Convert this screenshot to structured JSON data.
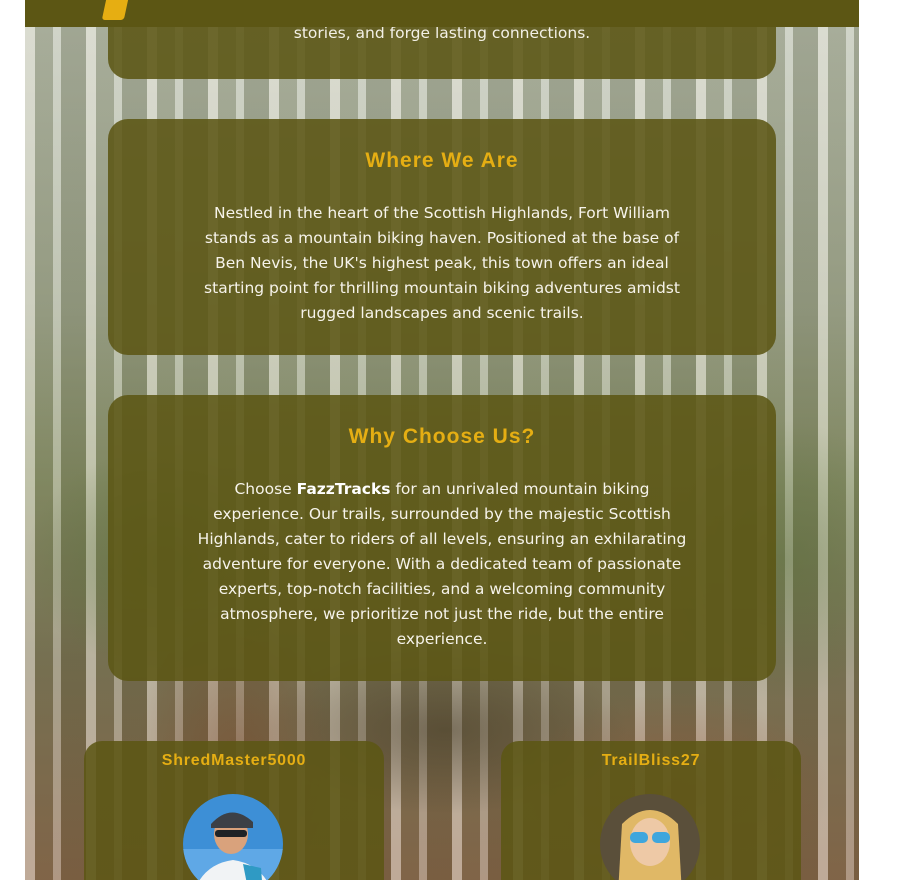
{
  "intro": {
    "tail_text": "stories, and forge lasting connections."
  },
  "where": {
    "heading": "Where We Are",
    "body": "Nestled in the heart of the Scottish Highlands, Fort William stands as a mountain biking haven. Positioned at the base of Ben Nevis, the UK's highest peak, this town offers an ideal starting point for thrilling mountain biking adventures amidst rugged landscapes and scenic trails."
  },
  "why": {
    "heading": "Why Choose Us?",
    "body_before": "Choose ",
    "brand": "FazzTracks",
    "body_after": " for an unrivaled mountain biking experience. Our trails, surrounded by the majestic Scottish Highlands, cater to riders of all levels, ensuring an exhilarating adventure for everyone. With a dedicated team of passionate experts, top-notch facilities, and a welcoming community atmosphere, we prioritize not just the ride, but the entire experience."
  },
  "reviews": [
    {
      "username": "ShredMaster5000",
      "avatar_icon": "cyclist-avatar"
    },
    {
      "username": "TrailBliss27",
      "avatar_icon": "rider-sunglasses-avatar"
    }
  ],
  "colors": {
    "card_bg": "#5c5614",
    "heading_accent": "#e5ae13",
    "body_text": "#ffffff"
  }
}
